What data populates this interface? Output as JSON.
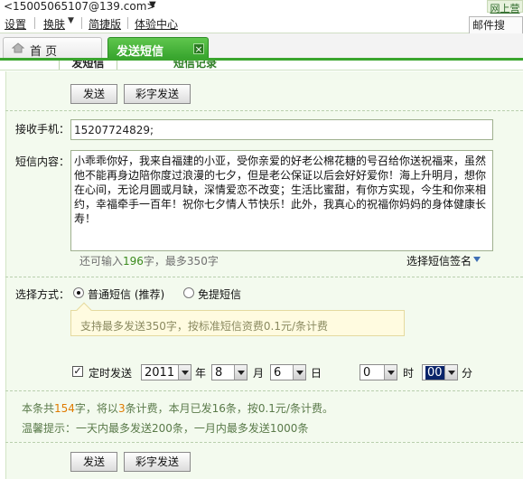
{
  "account": {
    "email": "<15005065107@139.com>",
    "corner_link": "网上营"
  },
  "menu": {
    "settings": "设置",
    "skin": "换肤",
    "simple": "简捷版",
    "experience": "体验中心",
    "right_box": "邮件搜"
  },
  "tabs": {
    "home": "首 页",
    "send_sms": "发送短信"
  },
  "subtabs": {
    "send": "发短信",
    "records": "短信记录"
  },
  "buttons": {
    "send": "发送",
    "color_send": "彩字发送"
  },
  "recipient": {
    "label": "接收手机：",
    "value": "15207724829;"
  },
  "content": {
    "label": "短信内容：",
    "text": "小乖乖你好，我来自福建的小亚，受你亲爱的好老公棉花糖的号召给你送祝福来，虽然他不能再身边陪你度过浪漫的七夕，但是老公保证以后会好好爱你！海上升明月，想你在心间，无论月圆或月缺，深情爱恋不改变；生活比蜜甜，有你方实现，今生和你来相约，幸福牵手一百年！祝你七夕情人节快乐！此外，我真心的祝福你妈妈的身体健康长寿！",
    "count_prefix": "还可输入",
    "count_value": "196",
    "count_suffix": "字，最多350字",
    "signature": "选择短信签名"
  },
  "method": {
    "label": "选择方式：",
    "normal": "普通短信 (推荐)",
    "free": "免提短信"
  },
  "tip": "支持最多发送350字，按标准短信资费0.1元/条计费",
  "schedule": {
    "label": "定时发送",
    "year": "2011",
    "year_unit": "年",
    "month": "8",
    "month_unit": "月",
    "day": "6",
    "day_unit": "日",
    "hour": "0",
    "hour_unit": "时",
    "minute": "00",
    "minute_unit": "分",
    "checked": true
  },
  "info": {
    "l1_a": "本条共",
    "l1_b": "154",
    "l1_c": "字，将以",
    "l1_d": "3",
    "l1_e": "条计费，本月已发16条，按0.1元/条计费。",
    "l2": "温馨提示：一天内最多发送200条，一月内最多发送1000条"
  },
  "colors": {
    "accent": "#33a12a",
    "panel": "#f3faee"
  }
}
